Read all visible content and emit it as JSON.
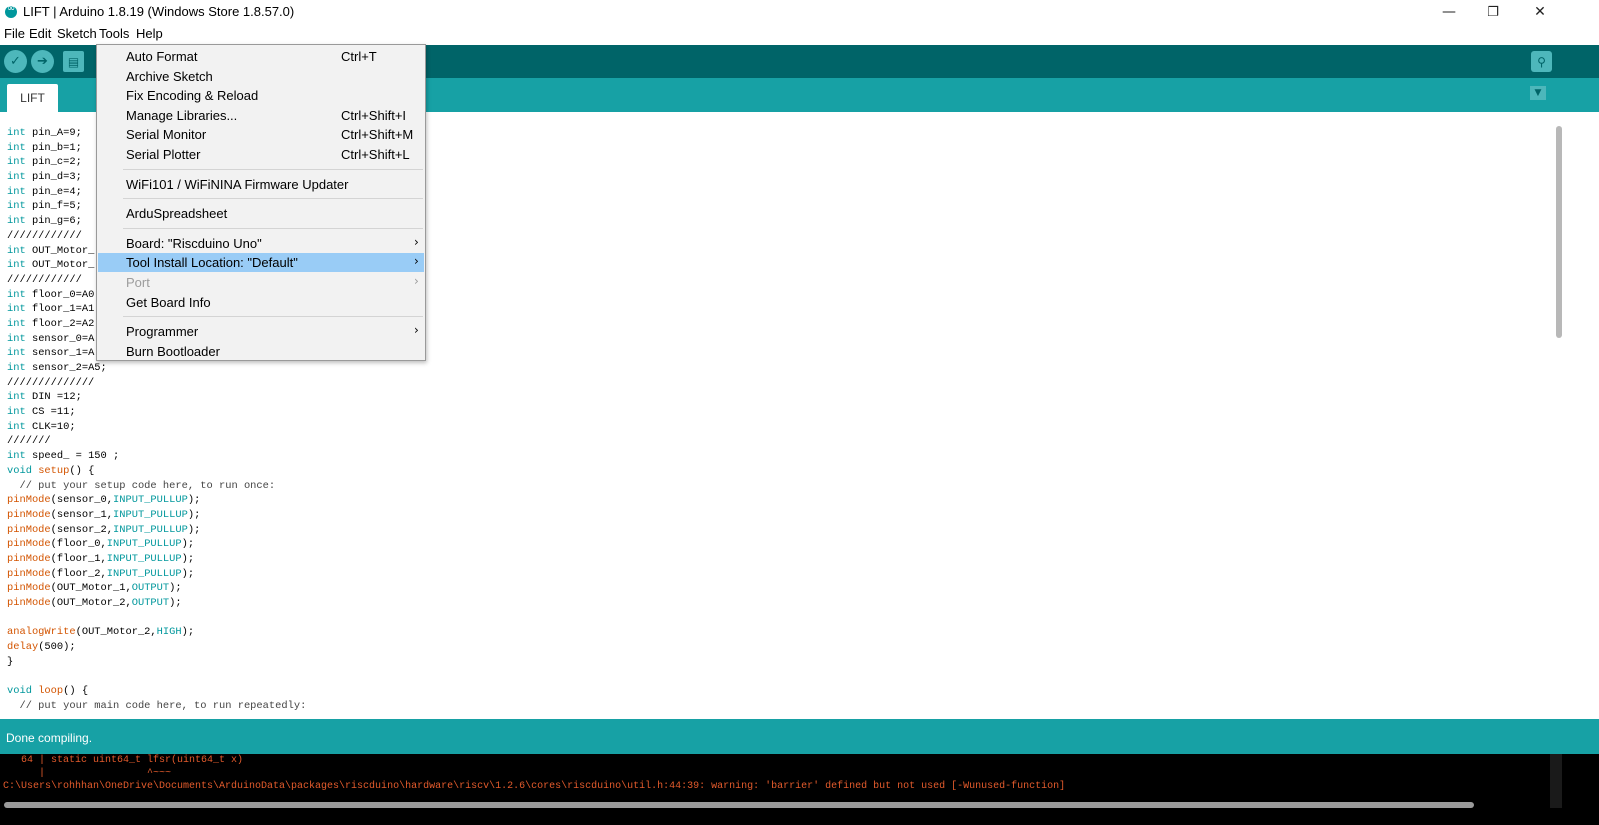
{
  "window": {
    "title": "LIFT | Arduino 1.8.19 (Windows Store 1.8.57.0)",
    "controls": {
      "minimize": "—",
      "maximize": "❐",
      "close": "✕"
    }
  },
  "menubar": [
    "File",
    "Edit",
    "Sketch",
    "Tools",
    "Help"
  ],
  "toolbar": {
    "verify_icon": "✓",
    "upload_icon": "➔",
    "new_icon": "▤",
    "serial_monitor_icon": "⚲"
  },
  "tabs": [
    {
      "label": "LIFT"
    }
  ],
  "tab_menu_icon": "▼",
  "code": [
    [
      [
        "kw",
        "int"
      ],
      [
        "",
        "pin_A=9;"
      ]
    ],
    [
      [
        "kw",
        "int"
      ],
      [
        "",
        "pin_b=1;"
      ]
    ],
    [
      [
        "kw",
        "int"
      ],
      [
        "",
        "pin_c=2;"
      ]
    ],
    [
      [
        "kw",
        "int"
      ],
      [
        "",
        "pin_d=3;"
      ]
    ],
    [
      [
        "kw",
        "int"
      ],
      [
        "",
        "pin_e=4;"
      ]
    ],
    [
      [
        "kw",
        "int"
      ],
      [
        "",
        "pin_f=5;"
      ]
    ],
    [
      [
        "kw",
        "int"
      ],
      [
        "",
        "pin_g=6;"
      ]
    ],
    [
      [
        "",
        "////////////"
      ]
    ],
    [
      [
        "kw",
        "int"
      ],
      [
        "",
        "OUT_Motor_"
      ]
    ],
    [
      [
        "kw",
        "int"
      ],
      [
        "",
        "OUT_Motor_"
      ]
    ],
    [
      [
        "",
        "////////////"
      ]
    ],
    [
      [
        "kw",
        "int"
      ],
      [
        "",
        "floor_0=A0"
      ]
    ],
    [
      [
        "kw",
        "int"
      ],
      [
        "",
        "floor_1=A1"
      ]
    ],
    [
      [
        "kw",
        "int"
      ],
      [
        "",
        "floor_2=A2"
      ]
    ],
    [
      [
        "kw",
        "int"
      ],
      [
        "",
        "sensor_0=A"
      ]
    ],
    [
      [
        "kw",
        "int"
      ],
      [
        "",
        "sensor_1=A"
      ]
    ],
    [
      [
        "kw",
        "int"
      ],
      [
        "",
        "sensor_2=A5;"
      ]
    ],
    [
      [
        "",
        "//////////////"
      ]
    ],
    [
      [
        "kw",
        "int"
      ],
      [
        "",
        "DIN =12;"
      ]
    ],
    [
      [
        "kw",
        "int"
      ],
      [
        "",
        "CS =11;"
      ]
    ],
    [
      [
        "kw",
        "int"
      ],
      [
        "",
        "CLK=10;"
      ]
    ],
    [
      [
        "",
        "///////"
      ]
    ],
    [
      [
        "kw",
        "int"
      ],
      [
        "",
        "speed_ = 150 ;"
      ]
    ],
    [
      [
        "kw",
        "void"
      ],
      [
        "",
        ""
      ],
      [
        "fn",
        "setup"
      ],
      [
        "",
        "() {"
      ]
    ],
    [
      [
        "cmt",
        "  // put your setup code here, to run once:"
      ]
    ],
    [
      [
        "fn",
        "pinMode"
      ],
      [
        "",
        "(sensor_0,"
      ],
      [
        "kw",
        "INPUT_PULLUP"
      ],
      [
        "",
        ");"
      ]
    ],
    [
      [
        "fn",
        "pinMode"
      ],
      [
        "",
        "(sensor_1,"
      ],
      [
        "kw",
        "INPUT_PULLUP"
      ],
      [
        "",
        ");"
      ]
    ],
    [
      [
        "fn",
        "pinMode"
      ],
      [
        "",
        "(sensor_2,"
      ],
      [
        "kw",
        "INPUT_PULLUP"
      ],
      [
        "",
        ");"
      ]
    ],
    [
      [
        "fn",
        "pinMode"
      ],
      [
        "",
        "(floor_0,"
      ],
      [
        "kw",
        "INPUT_PULLUP"
      ],
      [
        "",
        ");"
      ]
    ],
    [
      [
        "fn",
        "pinMode"
      ],
      [
        "",
        "(floor_1,"
      ],
      [
        "kw",
        "INPUT_PULLUP"
      ],
      [
        "",
        ");"
      ]
    ],
    [
      [
        "fn",
        "pinMode"
      ],
      [
        "",
        "(floor_2,"
      ],
      [
        "kw",
        "INPUT_PULLUP"
      ],
      [
        "",
        ");"
      ]
    ],
    [
      [
        "fn",
        "pinMode"
      ],
      [
        "",
        "(OUT_Motor_1,"
      ],
      [
        "kw",
        "OUTPUT"
      ],
      [
        "",
        ");"
      ]
    ],
    [
      [
        "fn",
        "pinMode"
      ],
      [
        "",
        "(OUT_Motor_2,"
      ],
      [
        "kw",
        "OUTPUT"
      ],
      [
        "",
        ");"
      ]
    ],
    [
      [
        "",
        ""
      ]
    ],
    [
      [
        "fn",
        "analogWrite"
      ],
      [
        "",
        "(OUT_Motor_2,"
      ],
      [
        "kw",
        "HIGH"
      ],
      [
        "",
        ");"
      ]
    ],
    [
      [
        "fn",
        "delay"
      ],
      [
        "",
        "(500);"
      ]
    ],
    [
      [
        "",
        "}"
      ]
    ],
    [
      [
        "",
        ""
      ]
    ],
    [
      [
        "kw",
        "void"
      ],
      [
        "",
        ""
      ],
      [
        "fn",
        "loop"
      ],
      [
        "",
        "() {"
      ]
    ],
    [
      [
        "cmt",
        "  // put your main code here, to run repeatedly:"
      ]
    ]
  ],
  "status": {
    "text": "Done compiling."
  },
  "console": [
    "   64 | static uint64_t lfsr(uint64_t x)",
    "      |                 ^~~~",
    "C:\\Users\\rohhhan\\OneDrive\\Documents\\ArduinoData\\packages\\riscduino\\hardware\\riscv\\1.2.6\\cores\\riscduino\\util.h:44:39: warning: 'barrier' defined but not used [-Wunused-function]"
  ],
  "tools_menu": [
    {
      "label": "Auto Format",
      "shortcut": "Ctrl+T"
    },
    {
      "label": "Archive Sketch",
      "shortcut": ""
    },
    {
      "label": "Fix Encoding & Reload",
      "shortcut": ""
    },
    {
      "label": "Manage Libraries...",
      "shortcut": "Ctrl+Shift+I"
    },
    {
      "label": "Serial Monitor",
      "shortcut": "Ctrl+Shift+M"
    },
    {
      "label": "Serial Plotter",
      "shortcut": "Ctrl+Shift+L"
    },
    {
      "separator": true
    },
    {
      "label": "WiFi101 / WiFiNINA Firmware Updater",
      "shortcut": ""
    },
    {
      "separator": true
    },
    {
      "label": "ArduSpreadsheet",
      "shortcut": ""
    },
    {
      "separator": true
    },
    {
      "label": "Board: \"Riscduino Uno\"",
      "shortcut": "",
      "submenu": true
    },
    {
      "label": "Tool Install Location: \"Default\"",
      "shortcut": "",
      "submenu": true,
      "highlighted": true
    },
    {
      "label": "Port",
      "shortcut": "",
      "submenu": true,
      "disabled": true
    },
    {
      "label": "Get Board Info",
      "shortcut": ""
    },
    {
      "separator": true
    },
    {
      "label": "Programmer",
      "shortcut": "",
      "submenu": true
    },
    {
      "label": "Burn Bootloader",
      "shortcut": ""
    }
  ],
  "submenu_arrow": "›",
  "colors": {
    "toolbar": "#006468",
    "tabstrip": "#17a1a5",
    "keyword": "#00979c",
    "function": "#d35400",
    "console_text": "#e35b2c",
    "menu_highlight": "#99ccf6"
  }
}
